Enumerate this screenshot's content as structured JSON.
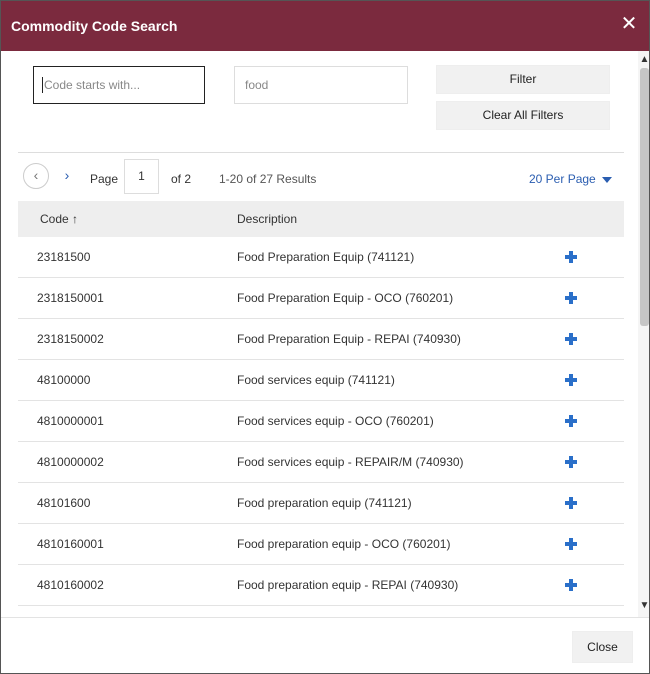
{
  "dialog": {
    "title": "Commodity Code Search",
    "close_glyph": "✕"
  },
  "filters": {
    "code_placeholder": "Code starts with...",
    "description_value": "food",
    "filter_button": "Filter",
    "clear_button": "Clear All Filters"
  },
  "pagination": {
    "prev_glyph": "‹",
    "next_glyph": "›",
    "page_label": "Page",
    "current_page": "1",
    "of_label": "of 2",
    "results_text": "1-20 of 27 Results",
    "per_page": "20 Per Page"
  },
  "table": {
    "headers": {
      "code": "Code ↑",
      "description": "Description"
    },
    "rows": [
      {
        "code": "23181500",
        "description": "Food Preparation Equip (741121)"
      },
      {
        "code": "2318150001",
        "description": "Food Preparation Equip - OCO (760201)"
      },
      {
        "code": "2318150002",
        "description": "Food Preparation Equip - REPAI (740930)"
      },
      {
        "code": "48100000",
        "description": "Food services equip (741121)"
      },
      {
        "code": "4810000001",
        "description": "Food services equip - OCO (760201)"
      },
      {
        "code": "4810000002",
        "description": "Food services equip - REPAIR/M (740930)"
      },
      {
        "code": "48101600",
        "description": "Food preparation equip (741121)"
      },
      {
        "code": "4810160001",
        "description": "Food preparation equip - OCO (760201)"
      },
      {
        "code": "4810160002",
        "description": "Food preparation equip - REPAI (740930)"
      },
      {
        "code": "",
        "description": ""
      }
    ]
  },
  "scrollbar": {
    "up_glyph": "▲",
    "down_glyph": "▼"
  },
  "footer": {
    "close_button": "Close"
  },
  "colors": {
    "title_bar": "#7b2a3e",
    "link_blue": "#2a5db0",
    "add_icon": "#2a6fc9"
  }
}
